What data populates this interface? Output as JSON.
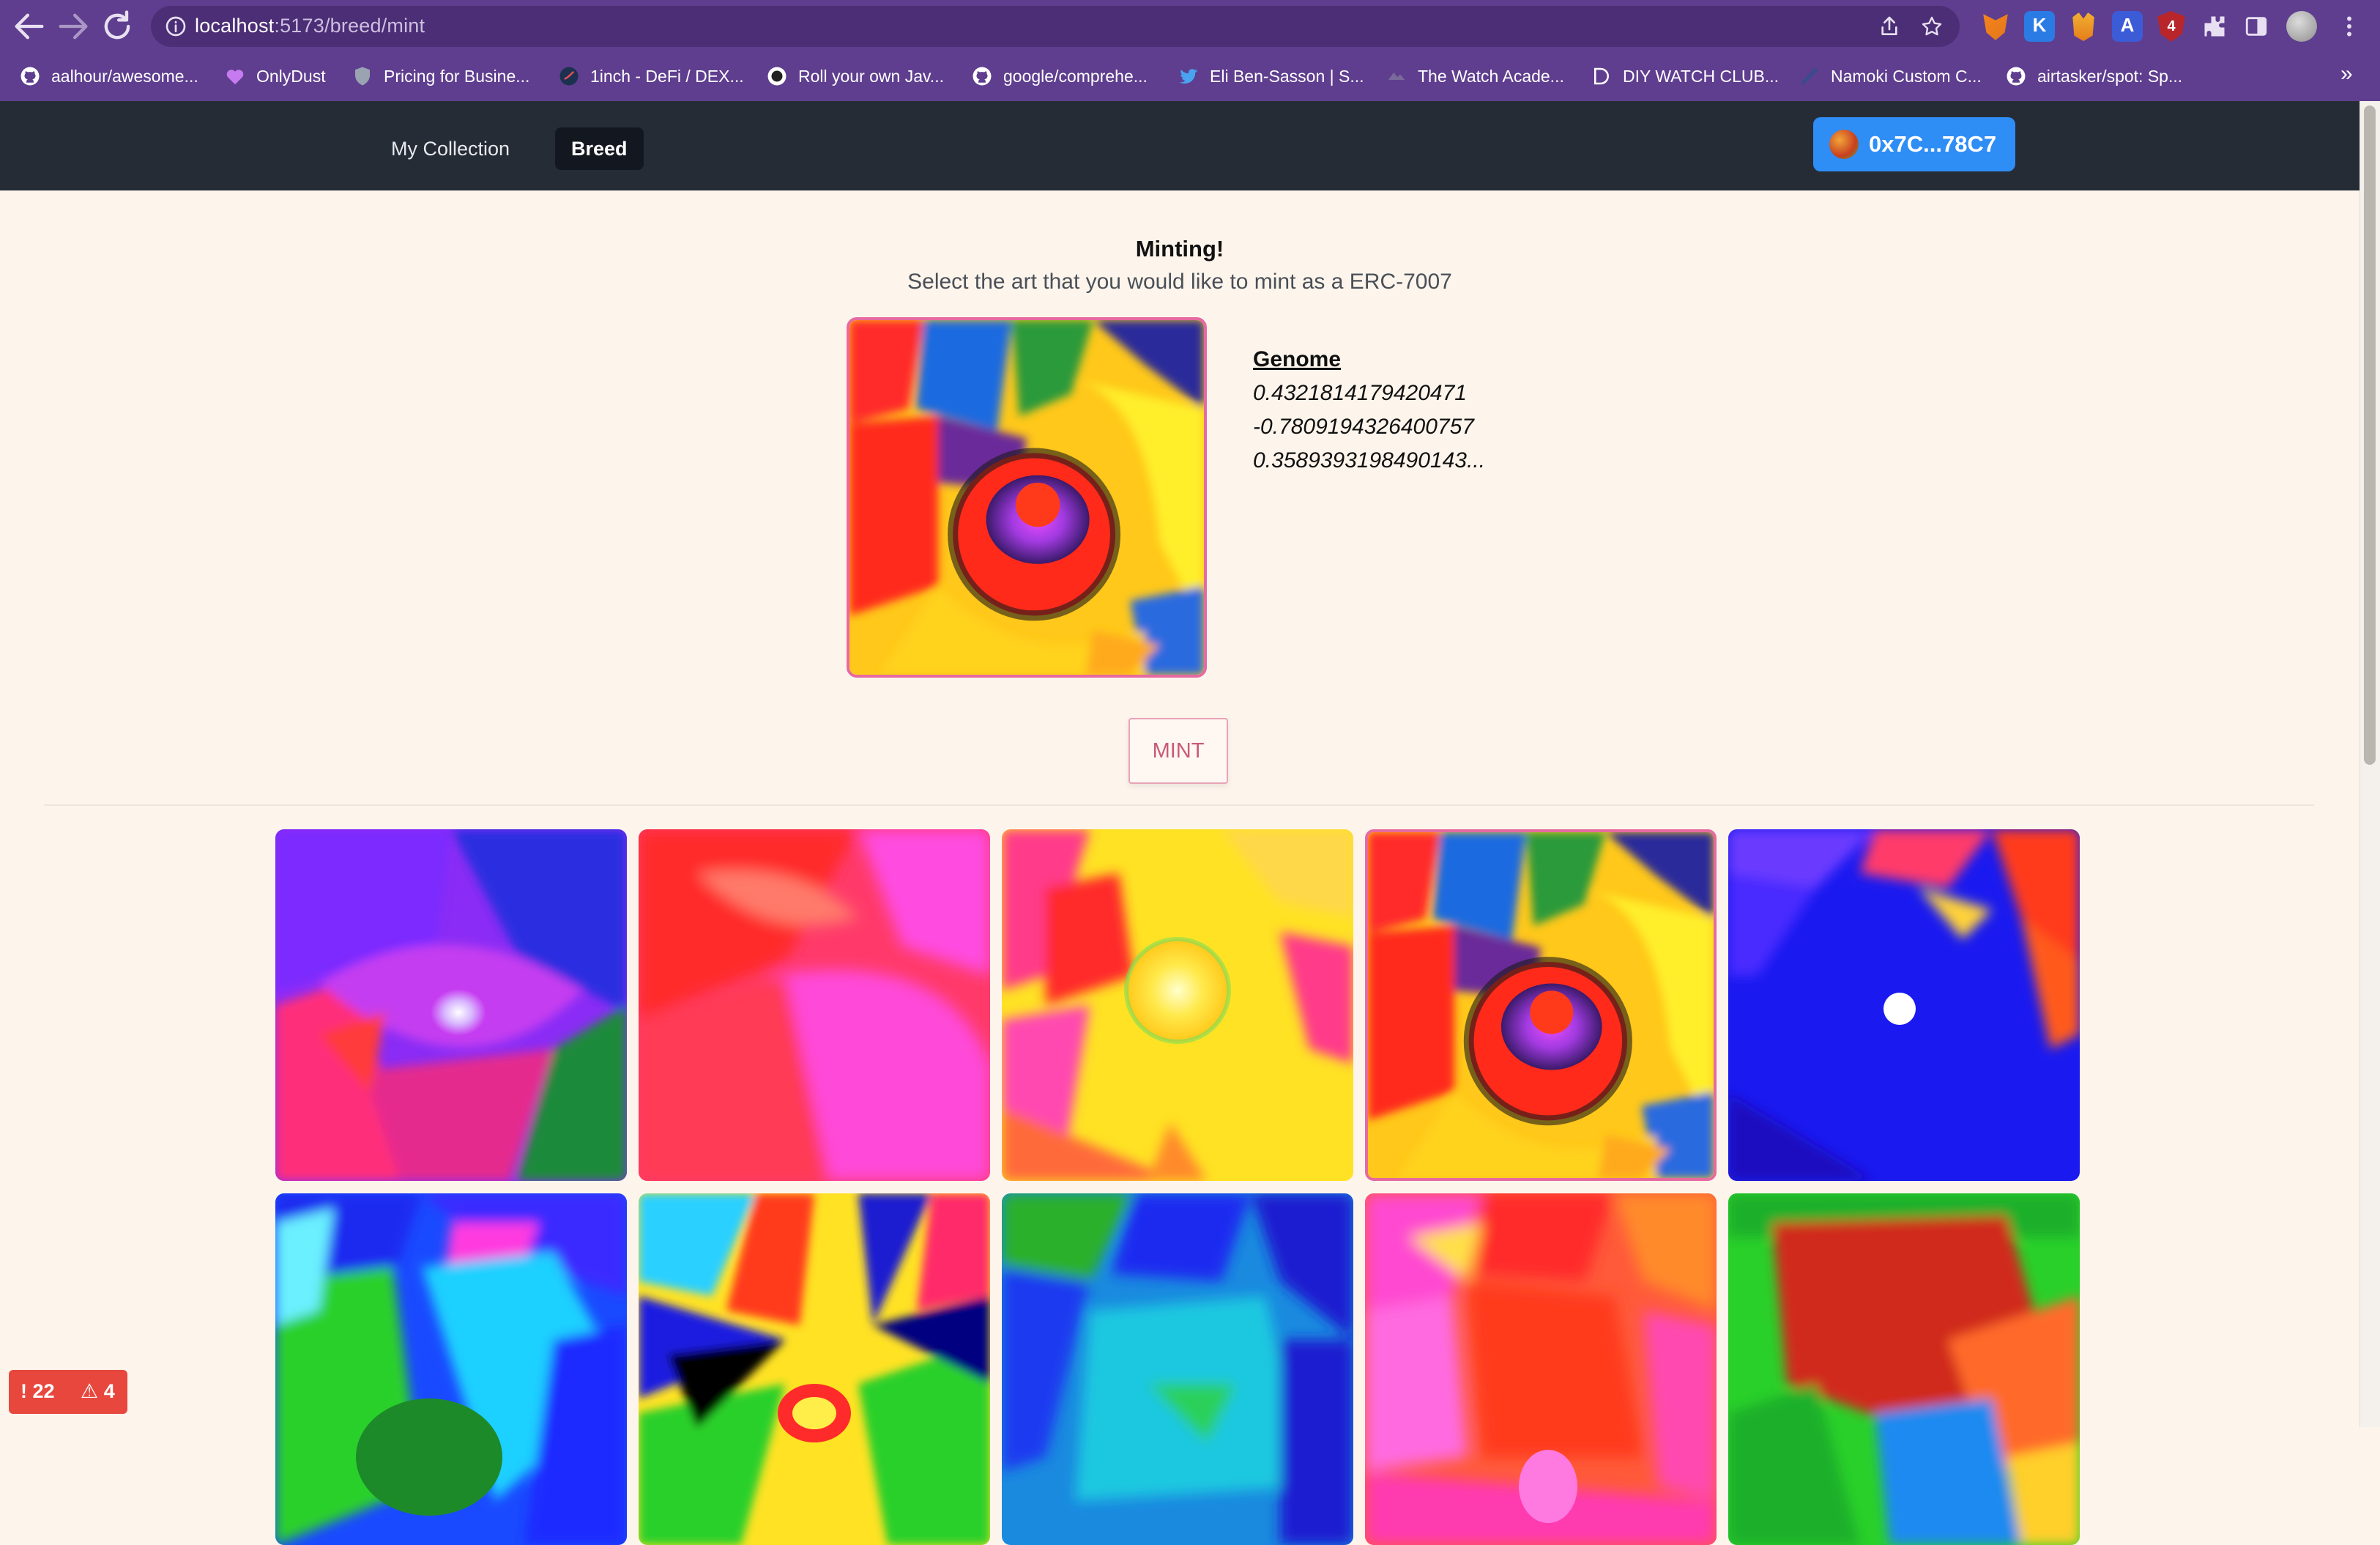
{
  "browser": {
    "url_host": "localhost",
    "url_path": ":5173/breed/mint",
    "extension_badge": "4",
    "bookmarks": [
      {
        "label": "aalhour/awesome...",
        "icon": "github-icon"
      },
      {
        "label": "OnlyDust",
        "icon": "onlydust-icon"
      },
      {
        "label": "Pricing for Busine...",
        "icon": "shield-icon"
      },
      {
        "label": "1inch - DeFi / DEX...",
        "icon": "1inch-icon"
      },
      {
        "label": "Roll your own Jav...",
        "icon": "rollup-icon"
      },
      {
        "label": "google/comprehe...",
        "icon": "github-icon"
      },
      {
        "label": "Eli Ben-Sasson | S...",
        "icon": "twitter-icon"
      },
      {
        "label": "The Watch Acade...",
        "icon": "watch-icon"
      },
      {
        "label": "DIY WATCH CLUB...",
        "icon": "diy-icon"
      },
      {
        "label": "Namoki Custom C...",
        "icon": "namoki-icon"
      },
      {
        "label": "airtasker/spot: Sp...",
        "icon": "github-icon"
      }
    ],
    "bookmarks_more": "»"
  },
  "header": {
    "nav": [
      {
        "label": "My Collection",
        "active": false
      },
      {
        "label": "Breed",
        "active": true
      }
    ],
    "wallet_address": "0x7C...78C7"
  },
  "page": {
    "title": "Minting!",
    "subtitle": "Select the art that you would like to mint as a ERC-7007",
    "genome_label": "Genome",
    "genome_values": [
      "0.4321814179420471",
      "-0.7809194326400757",
      "0.3589393198490143..."
    ],
    "mint_label": "MINT",
    "gallery_selected_index": 3
  },
  "status": {
    "errors": "22",
    "warnings": "4"
  },
  "colors": {
    "accent_pink": "#e66aa0",
    "wallet_blue": "#2f8df6",
    "header_bg": "#252c36",
    "chrome_purple": "#5f3e8f"
  }
}
